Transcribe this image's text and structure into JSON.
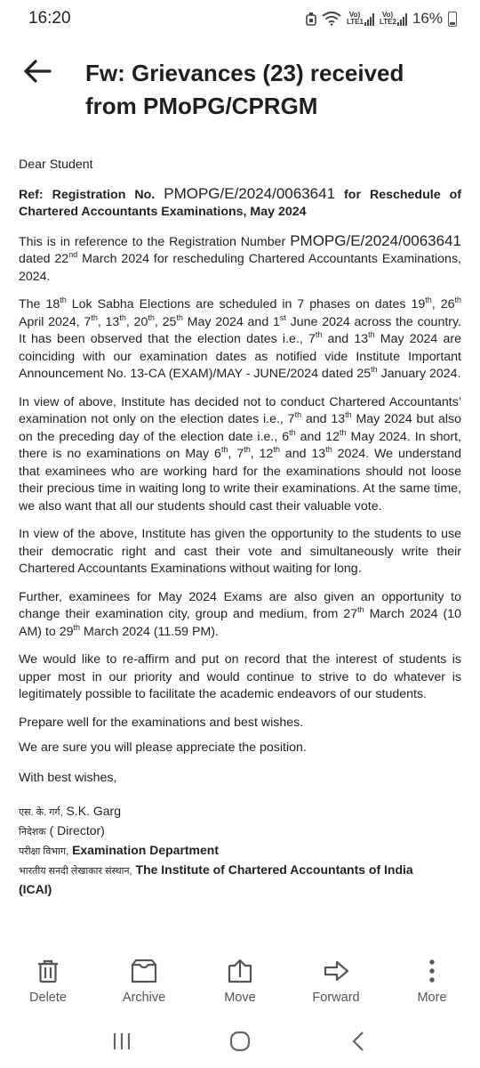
{
  "status": {
    "time": "16:20",
    "battery": "16%",
    "sim1": "Vo) LTE1",
    "sim2": "Vo) LTE2"
  },
  "header": {
    "subject": "Fw: Grievances (23) received from PMoPG/CPRGM",
    "back_icon": "arrow-left-icon"
  },
  "email": {
    "greeting": "Dear Student",
    "ref_label": "Ref: Registration No.",
    "reg_no": "PMOPG/E/2024/0063641",
    "ref_tail": "for Reschedule of Chartered Accountants Examinations, May 2024",
    "p1_a": "This is in reference to the Registration Number",
    "p1_b": "dated 22",
    "p1_sup": "nd",
    "p1_c": "March 2024 for rescheduling Chartered Accountants Examinations, 2024.",
    "p2": [
      {
        "t": "The 18"
      },
      {
        "s": "th"
      },
      {
        "t": " Lok Sabha Elections are scheduled in 7 phases on dates 19"
      },
      {
        "s": "th"
      },
      {
        "t": ", 26"
      },
      {
        "s": "th"
      },
      {
        "t": " April 2024, 7"
      },
      {
        "s": "th"
      },
      {
        "t": ", 13"
      },
      {
        "s": "th"
      },
      {
        "t": ", 20"
      },
      {
        "s": "th"
      },
      {
        "t": ", 25"
      },
      {
        "s": "th"
      },
      {
        "t": " May 2024 and 1"
      },
      {
        "s": "st"
      },
      {
        "t": " June 2024 across the country. It has been observed that the election dates i.e., 7"
      },
      {
        "s": "th"
      },
      {
        "t": " and 13"
      },
      {
        "s": "th"
      },
      {
        "t": " May 2024 are coinciding with our examination dates as notified vide Institute Important Announcement No. 13-CA (EXAM)/MAY - JUNE/2024 dated 25"
      },
      {
        "s": "th"
      },
      {
        "t": " January 2024."
      }
    ],
    "p3": [
      {
        "t": "In view of above, Institute has decided not to conduct Chartered Accountants’ examination not only on the election dates i.e., 7"
      },
      {
        "s": "th"
      },
      {
        "t": " and 13"
      },
      {
        "s": "th"
      },
      {
        "t": " May 2024 but also on the preceding day of the election date i.e., 6"
      },
      {
        "s": "th"
      },
      {
        "t": " and 12"
      },
      {
        "s": "th"
      },
      {
        "t": " May 2024. In short, there is no examinations on May 6"
      },
      {
        "s": "th"
      },
      {
        "t": ", 7"
      },
      {
        "s": "th"
      },
      {
        "t": ", 12"
      },
      {
        "s": "th"
      },
      {
        "t": " and 13"
      },
      {
        "s": "th"
      },
      {
        "t": " 2024. We understand that examinees who are working hard for the examinations should not loose their precious time in waiting long to write their examinations. At the same time, we also want that all our students should cast their valuable vote."
      }
    ],
    "p4": "In view of the above, Institute has given the opportunity to the students to use their democratic right and cast their vote and simultaneously write their Chartered Accountants Examinations without waiting for long.",
    "p5": [
      {
        "t": "Further, examinees for May 2024 Exams are also given an opportunity to change their examination city, group and medium, from 27"
      },
      {
        "s": "th"
      },
      {
        "t": " March 2024 (10 AM) to 29"
      },
      {
        "s": "th"
      },
      {
        "t": " March 2024 (11.59 PM)."
      }
    ],
    "p6": "We would like to re-affirm and put on record that the interest of students is upper most in our priority and would continue to strive to do whatever is legitimately possible to facilitate the academic endeavors of our students.",
    "p7": "Prepare well for the examinations and best wishes.",
    "p8": "We are sure you will please appreciate the position.",
    "closing": "With best wishes,",
    "sig1_hi": "एस. के. गर्ग,",
    "sig1": "S.K. Garg",
    "sig2_hi": "निदेशक",
    "sig2": "( Director)",
    "sig3_hi": "परीक्षा विभाग,",
    "sig3": "Examination Department",
    "sig4_hi": "भारतीय सनदी लेखाकार संस्थान,",
    "sig4": "The Institute of Chartered Accountants of India",
    "sig5": "(ICAI)"
  },
  "actions": [
    {
      "label": "Delete",
      "icon": "trash-icon"
    },
    {
      "label": "Archive",
      "icon": "archive-icon"
    },
    {
      "label": "Move",
      "icon": "move-icon"
    },
    {
      "label": "Forward",
      "icon": "forward-icon"
    },
    {
      "label": "More",
      "icon": "more-vertical-icon"
    }
  ],
  "nav": {
    "recents_icon": "recents-icon",
    "home_icon": "home-icon",
    "back_icon": "back-chevron-icon"
  },
  "colors": {
    "text": "#222222",
    "icon": "#555555",
    "background": "#ffffff"
  }
}
